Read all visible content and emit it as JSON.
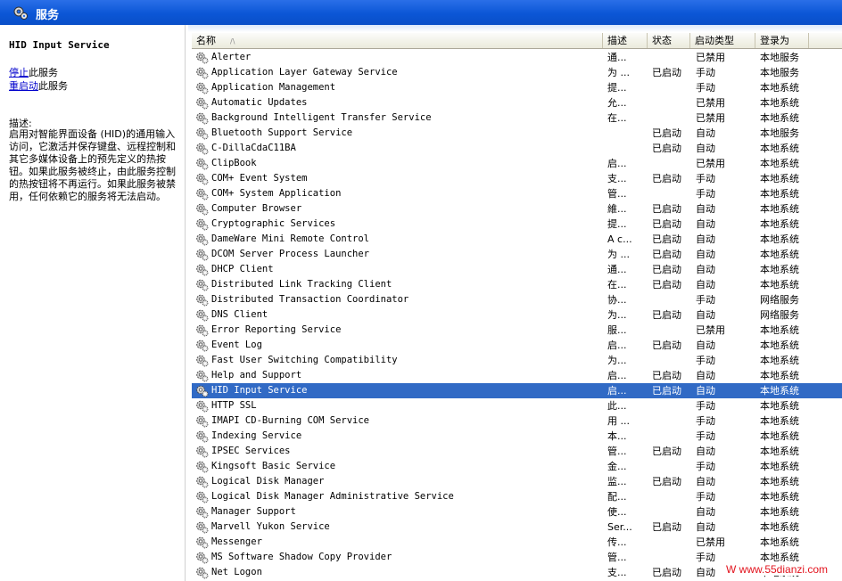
{
  "header": {
    "title": "服务"
  },
  "details": {
    "selected_name": "HID Input Service",
    "stop_link": "停止",
    "stop_suffix": "此服务",
    "restart_link": "重启动",
    "restart_suffix": "此服务",
    "description_label": "描述:",
    "description": "启用对智能界面设备 (HID)的通用输入访问，它激活并保存键盘、远程控制和其它多媒体设备上的预先定义的热按钮。如果此服务被终止，由此服务控制的热按钮将不再运行。如果此服务被禁用，任何依赖它的服务将无法启动。"
  },
  "columns": {
    "name": "名称",
    "desc": "描述",
    "status": "状态",
    "start": "启动类型",
    "logon": "登录为"
  },
  "services": [
    {
      "name": "Alerter",
      "desc": "通...",
      "status": "",
      "start": "已禁用",
      "logon": "本地服务"
    },
    {
      "name": "Application Layer Gateway Service",
      "desc": "为 ...",
      "status": "已启动",
      "start": "手动",
      "logon": "本地服务"
    },
    {
      "name": "Application Management",
      "desc": "提...",
      "status": "",
      "start": "手动",
      "logon": "本地系统"
    },
    {
      "name": "Automatic Updates",
      "desc": "允...",
      "status": "",
      "start": "已禁用",
      "logon": "本地系统"
    },
    {
      "name": "Background Intelligent Transfer Service",
      "desc": "在...",
      "status": "",
      "start": "已禁用",
      "logon": "本地系统"
    },
    {
      "name": "Bluetooth Support Service",
      "desc": "",
      "status": "已启动",
      "start": "自动",
      "logon": "本地服务"
    },
    {
      "name": "C-DillaCdaC11BA",
      "desc": "",
      "status": "已启动",
      "start": "自动",
      "logon": "本地系统"
    },
    {
      "name": "ClipBook",
      "desc": "启...",
      "status": "",
      "start": "已禁用",
      "logon": "本地系统"
    },
    {
      "name": "COM+ Event System",
      "desc": "支...",
      "status": "已启动",
      "start": "手动",
      "logon": "本地系统"
    },
    {
      "name": "COM+ System Application",
      "desc": "管...",
      "status": "",
      "start": "手动",
      "logon": "本地系统"
    },
    {
      "name": "Computer Browser",
      "desc": "維...",
      "status": "已启动",
      "start": "自动",
      "logon": "本地系统"
    },
    {
      "name": "Cryptographic Services",
      "desc": "提...",
      "status": "已启动",
      "start": "自动",
      "logon": "本地系统"
    },
    {
      "name": "DameWare Mini Remote Control",
      "desc": "A c...",
      "status": "已启动",
      "start": "自动",
      "logon": "本地系统"
    },
    {
      "name": "DCOM Server Process Launcher",
      "desc": "为 ...",
      "status": "已启动",
      "start": "自动",
      "logon": "本地系统"
    },
    {
      "name": "DHCP Client",
      "desc": "通...",
      "status": "已启动",
      "start": "自动",
      "logon": "本地系统"
    },
    {
      "name": "Distributed Link Tracking Client",
      "desc": "在...",
      "status": "已启动",
      "start": "自动",
      "logon": "本地系统"
    },
    {
      "name": "Distributed Transaction Coordinator",
      "desc": "协...",
      "status": "",
      "start": "手动",
      "logon": "网络服务"
    },
    {
      "name": "DNS Client",
      "desc": "为...",
      "status": "已启动",
      "start": "自动",
      "logon": "网络服务"
    },
    {
      "name": "Error Reporting Service",
      "desc": "服...",
      "status": "",
      "start": "已禁用",
      "logon": "本地系统"
    },
    {
      "name": "Event Log",
      "desc": "启...",
      "status": "已启动",
      "start": "自动",
      "logon": "本地系统"
    },
    {
      "name": "Fast User Switching Compatibility",
      "desc": "为...",
      "status": "",
      "start": "手动",
      "logon": "本地系统"
    },
    {
      "name": "Help and Support",
      "desc": "启...",
      "status": "已启动",
      "start": "自动",
      "logon": "本地系统"
    },
    {
      "name": "HID Input Service",
      "desc": "启...",
      "status": "已启动",
      "start": "自动",
      "logon": "本地系统",
      "selected": true
    },
    {
      "name": "HTTP SSL",
      "desc": "此...",
      "status": "",
      "start": "手动",
      "logon": "本地系统"
    },
    {
      "name": "IMAPI CD-Burning COM Service",
      "desc": "用 ...",
      "status": "",
      "start": "手动",
      "logon": "本地系统"
    },
    {
      "name": "Indexing Service",
      "desc": "本...",
      "status": "",
      "start": "手动",
      "logon": "本地系统"
    },
    {
      "name": "IPSEC Services",
      "desc": "管...",
      "status": "已启动",
      "start": "自动",
      "logon": "本地系统"
    },
    {
      "name": "Kingsoft Basic Service",
      "desc": "金...",
      "status": "",
      "start": "手动",
      "logon": "本地系统"
    },
    {
      "name": "Logical Disk Manager",
      "desc": "监...",
      "status": "已启动",
      "start": "自动",
      "logon": "本地系统"
    },
    {
      "name": "Logical Disk Manager Administrative Service",
      "desc": "配...",
      "status": "",
      "start": "手动",
      "logon": "本地系统"
    },
    {
      "name": "Manager Support",
      "desc": "使...",
      "status": "",
      "start": "自动",
      "logon": "本地系统"
    },
    {
      "name": "Marvell Yukon Service",
      "desc": "Ser...",
      "status": "已启动",
      "start": "自动",
      "logon": "本地系统"
    },
    {
      "name": "Messenger",
      "desc": "传...",
      "status": "",
      "start": "已禁用",
      "logon": "本地系统"
    },
    {
      "name": "MS Software Shadow Copy Provider",
      "desc": "管...",
      "status": "",
      "start": "手动",
      "logon": "本地系统"
    },
    {
      "name": "Net Logon",
      "desc": "支...",
      "status": "已启动",
      "start": "自动",
      "logon": "本地系统"
    }
  ],
  "watermark": "W   www.55dianzi.com"
}
